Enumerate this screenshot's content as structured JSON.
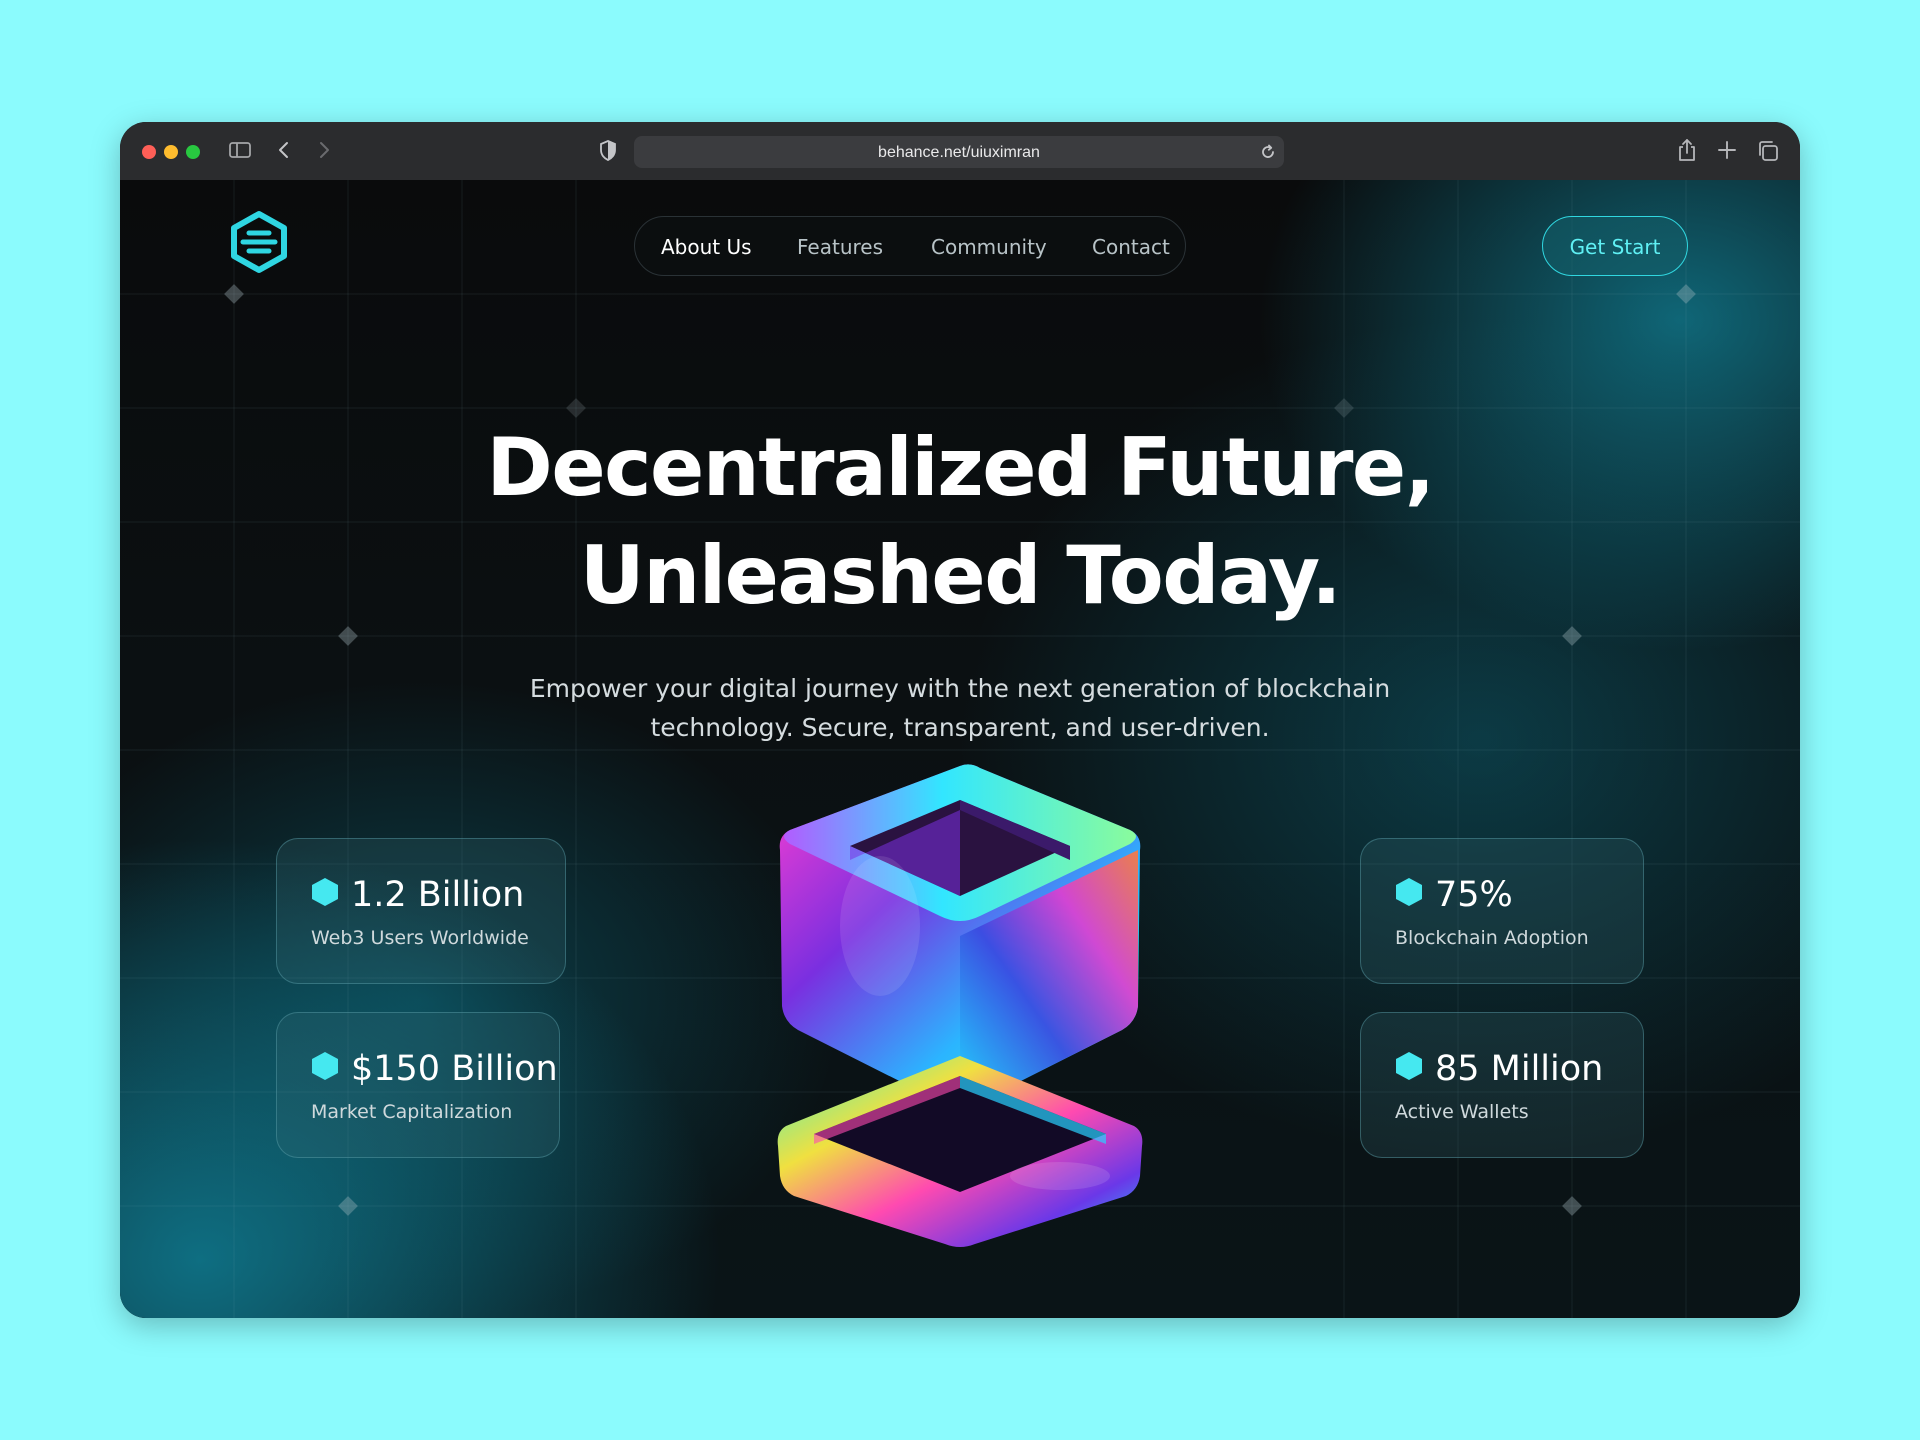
{
  "browser": {
    "url": "behance.net/uiuximran",
    "icons": [
      "sidebar-icon",
      "back-icon",
      "forward-icon",
      "shield-icon",
      "reload-icon",
      "share-icon",
      "new-tab-icon",
      "tabs-overview-icon"
    ],
    "traffic_colors": [
      "#fe5f57",
      "#febc2e",
      "#28c840"
    ]
  },
  "nav": {
    "items": [
      {
        "label": "About Us",
        "active": true
      },
      {
        "label": "Features",
        "active": false
      },
      {
        "label": "Community",
        "active": false
      },
      {
        "label": "Contact",
        "active": false
      }
    ],
    "cta": "Get Start"
  },
  "hero": {
    "title_line1": "Decentralized Future,",
    "title_line2": "Unleashed Today.",
    "subtitle_line1": "Empower your digital journey with the next generation of blockchain",
    "subtitle_line2": "technology. Secure, transparent, and user-driven."
  },
  "stats": [
    {
      "value": "1.2 Billion",
      "label": "Web3 Users Worldwide"
    },
    {
      "value": "$150 Billion",
      "label": "Market Capitalization"
    },
    {
      "value": "75%",
      "label": "Blockchain Adoption"
    },
    {
      "value": "85 Million",
      "label": "Active Wallets"
    }
  ],
  "colors": {
    "accent": "#30d7e0",
    "accent_text": "#5ff0f4",
    "page_bg": "#8bfbfd",
    "site_bg": "#07090b"
  }
}
